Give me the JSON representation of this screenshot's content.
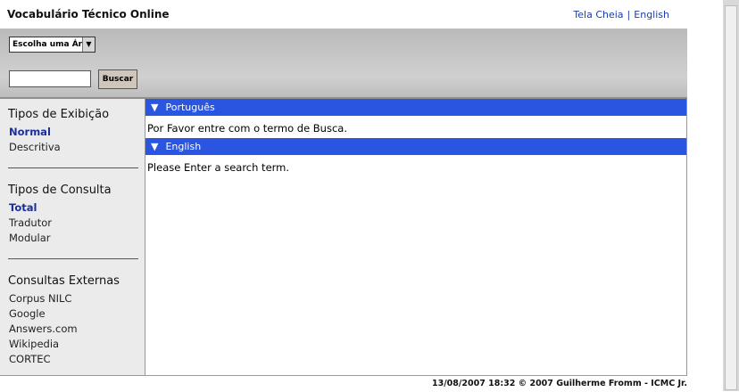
{
  "header": {
    "title": "Vocabulário Técnico Online",
    "links": [
      "Tela Cheia",
      "English"
    ],
    "separator": "|"
  },
  "search": {
    "area_select": "Escolha uma Área",
    "input_value": "",
    "button_label": "Buscar"
  },
  "sidebar": {
    "display_types": {
      "title": "Tipos de Exibição",
      "items": [
        "Normal",
        "Descritiva"
      ],
      "active": "Normal"
    },
    "query_types": {
      "title": "Tipos de Consulta",
      "items": [
        "Total",
        "Tradutor",
        "Modular"
      ],
      "active": "Total"
    },
    "external": {
      "title": "Consultas Externas",
      "items": [
        "Corpus NILC",
        "Google",
        "Answers.com",
        "Wikipedia",
        "CORTEC"
      ]
    }
  },
  "main": {
    "sections": [
      {
        "label": "Português",
        "message": "Por Favor entre com o termo de Busca."
      },
      {
        "label": "English",
        "message": "Please Enter a search term."
      }
    ]
  },
  "footer": {
    "text": "13/08/2007 18:32 © 2007 Guilherme Fromm - ICMC Jr."
  },
  "colors": {
    "section_bar": "#2a55e0",
    "active_item": "#1a2f9e",
    "link": "#1a3ca8"
  },
  "icons": {
    "section_toggle": "triangle-down-icon",
    "select_arrow": "chevron-down-icon"
  }
}
